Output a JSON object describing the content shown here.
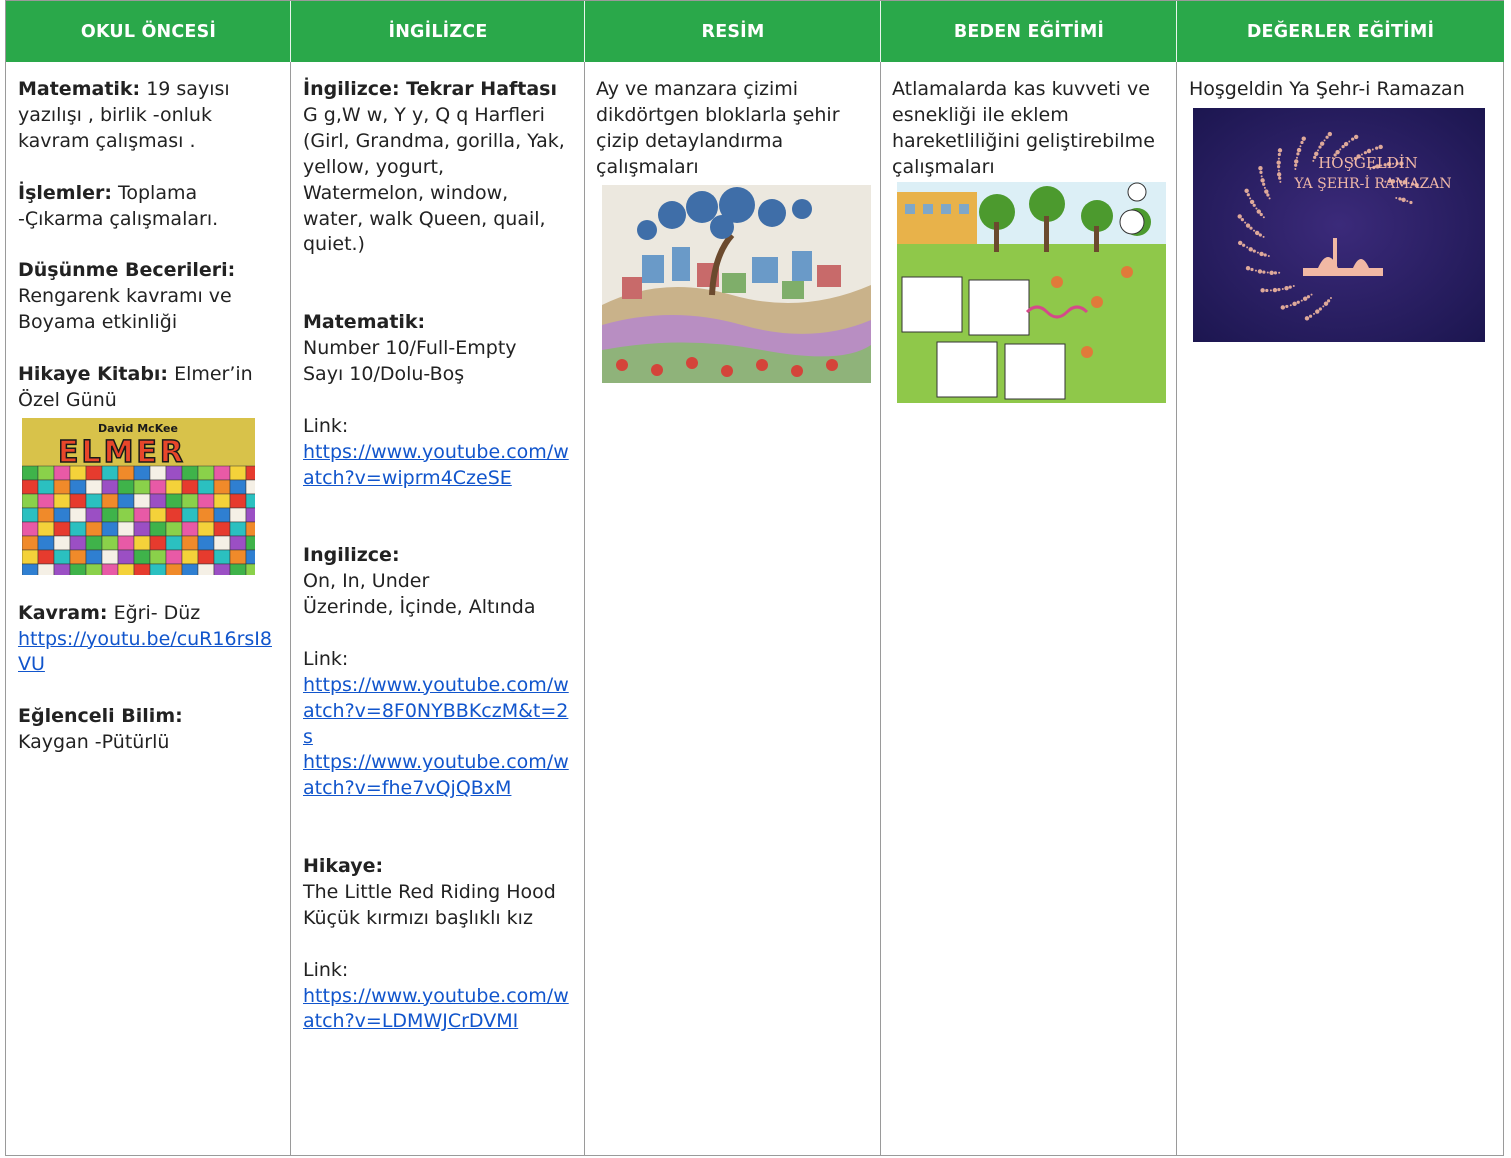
{
  "headers": [
    "OKUL ÖNCESİ",
    "İNGİLİZCE",
    "RESİM",
    "BEDEN EĞİTİMİ",
    "DEĞERLER EĞİTİMİ"
  ],
  "okul_oncesi": {
    "matematik_label": "Matematik:",
    "matematik_text": " 19 sayısı yazılışı , birlik -onluk kavram çalışması .",
    "islemler_label": "İşlemler:",
    "islemler_text": " Toplama -Çıkarma çalışmaları.",
    "dusunme_label": "Düşünme Becerileri:",
    "dusunme_text": "Rengarenk kavramı ve Boyama etkinliği",
    "hikaye_label": "Hikaye Kitabı:",
    "hikaye_text": " Elmer’in Özel Günü",
    "book_author": "David McKee",
    "book_title": "ELMER",
    "kavram_label": "Kavram:",
    "kavram_text": " Eğri- Düz",
    "kavram_link": "https://youtu.be/cuR16rsI8VU",
    "bilim_label": "Eğlenceli Bilim:",
    "bilim_text": "Kaygan -Pütürlü"
  },
  "ingilizce": {
    "tekrar_label": "İngilizce: Tekrar Haftası",
    "tekrar_text": "G g,W w, Y y, Q q Harfleri (Girl, Grandma, gorilla, Yak, yellow, yogurt, Watermelon, window, water, walk Queen, quail, quiet.)",
    "matematik_label": "Matematik:",
    "matematik_line1": "Number 10/Full-Empty",
    "matematik_line2": "Sayı 10/Dolu-Boş",
    "link_label_1": "Link:",
    "link_1": "https://www.youtube.com/watch?v=wiprm4CzeSE",
    "ingilizce_label": "Ingilizce:",
    "ingilizce_line1": "On, In, Under",
    "ingilizce_line2": "Üzerinde, İçinde, Altında",
    "link_label_2": "Link:",
    "link_2a": "https://www.youtube.com/watch?v=8F0NYBBKczM&t=2s",
    "link_2b": "https://www.youtube.com/watch?v=fhe7vQjQBxM",
    "hikaye_label": "Hikaye:",
    "hikaye_line1": "The Little Red Riding Hood",
    "hikaye_line2": "Küçük kırmızı başlıklı kız",
    "link_label_3": "Link:",
    "link_3": "https://www.youtube.com/watch?v=LDMWJCrDVMI"
  },
  "resim": {
    "text": "Ay  ve manzara çizimi dikdörtgen bloklarla şehir çizip detaylandırma çalışmaları"
  },
  "beden": {
    "text": "Atlamalarda kas kuvveti ve esnekliği ile eklem hareketliliğini geliştirebilme çalışmaları"
  },
  "degerler": {
    "text": "Hoşgeldin Ya Şehr-i Ramazan",
    "banner_line1": "HOŞGELDİN",
    "banner_line2": "YA ŞEHR-İ RAMAZAN"
  },
  "colors": {
    "header_bg": "#2aa84a",
    "header_text": "#ffffff",
    "link": "#1155cc",
    "border": "#9a9a9a"
  }
}
